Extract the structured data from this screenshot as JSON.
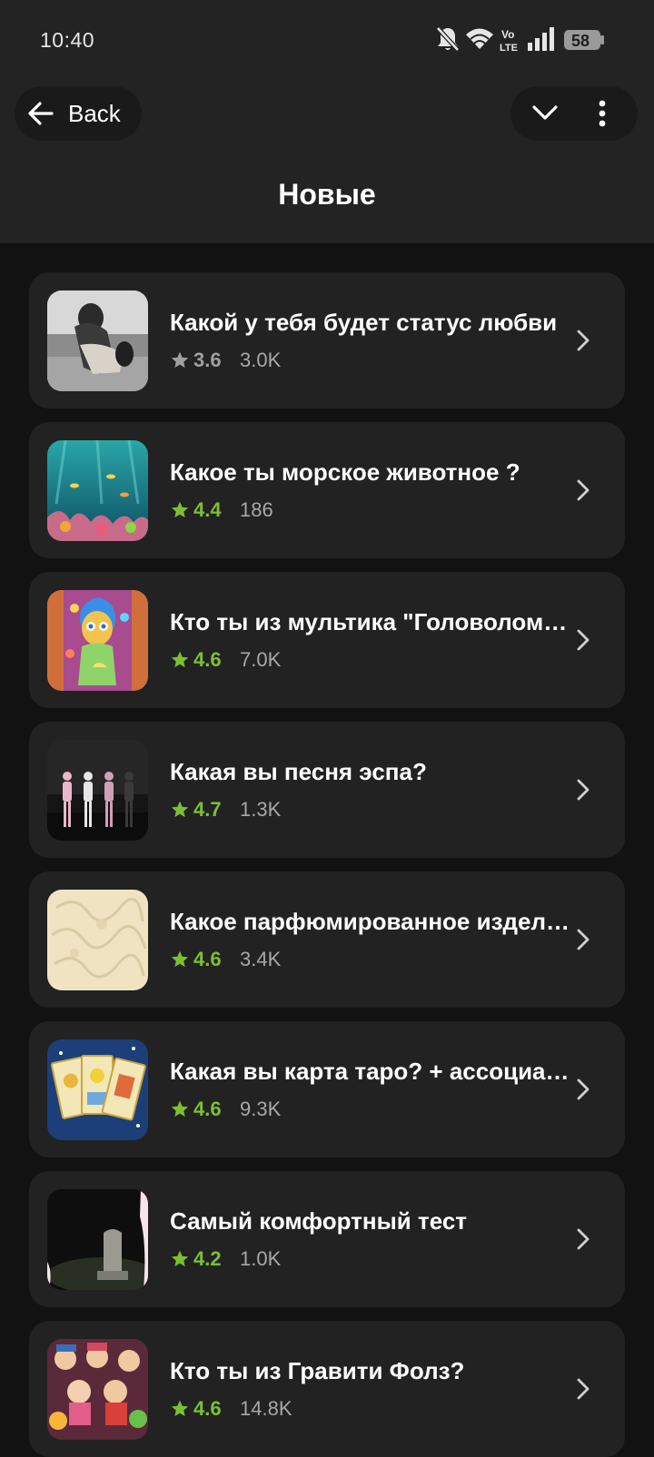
{
  "status_bar": {
    "time": "10:40",
    "battery": "58",
    "icons": [
      "bell-muted-icon",
      "wifi-icon",
      "volte-icon",
      "signal-icon",
      "battery-icon"
    ]
  },
  "header": {
    "back_label": "Back",
    "title": "Новые"
  },
  "colors": {
    "header_bg": "#232323",
    "page_bg": "#121212",
    "card_bg": "#222222",
    "rating_green": "#7dc02f",
    "rating_gray": "#a0a0a0",
    "count_gray": "#a8a8a8"
  },
  "items": [
    {
      "title": "Какой у тебя будет статус любви",
      "rating": "3.6",
      "count": "3.0K",
      "rating_color": "#a0a0a0"
    },
    {
      "title": "Какое ты морское животное ?",
      "rating": "4.4",
      "count": "186",
      "rating_color": "#7dc02f"
    },
    {
      "title": "Кто ты из мультика \"Головоломка\"",
      "rating": "4.6",
      "count": "7.0K",
      "rating_color": "#7dc02f"
    },
    {
      "title": "Какая вы песня эспа?",
      "rating": "4.7",
      "count": "1.3K",
      "rating_color": "#7dc02f"
    },
    {
      "title": "Какое парфюмированное изделие",
      "rating": "4.6",
      "count": "3.4K",
      "rating_color": "#7dc02f"
    },
    {
      "title": "Какая вы карта таро? + ассоциации",
      "rating": "4.6",
      "count": "9.3K",
      "rating_color": "#7dc02f"
    },
    {
      "title": "Самый комфортный тест",
      "rating": "4.2",
      "count": "1.0K",
      "rating_color": "#7dc02f"
    },
    {
      "title": "Кто ты из Гравити Фолз?",
      "rating": "4.6",
      "count": "14.8K",
      "rating_color": "#7dc02f"
    }
  ]
}
